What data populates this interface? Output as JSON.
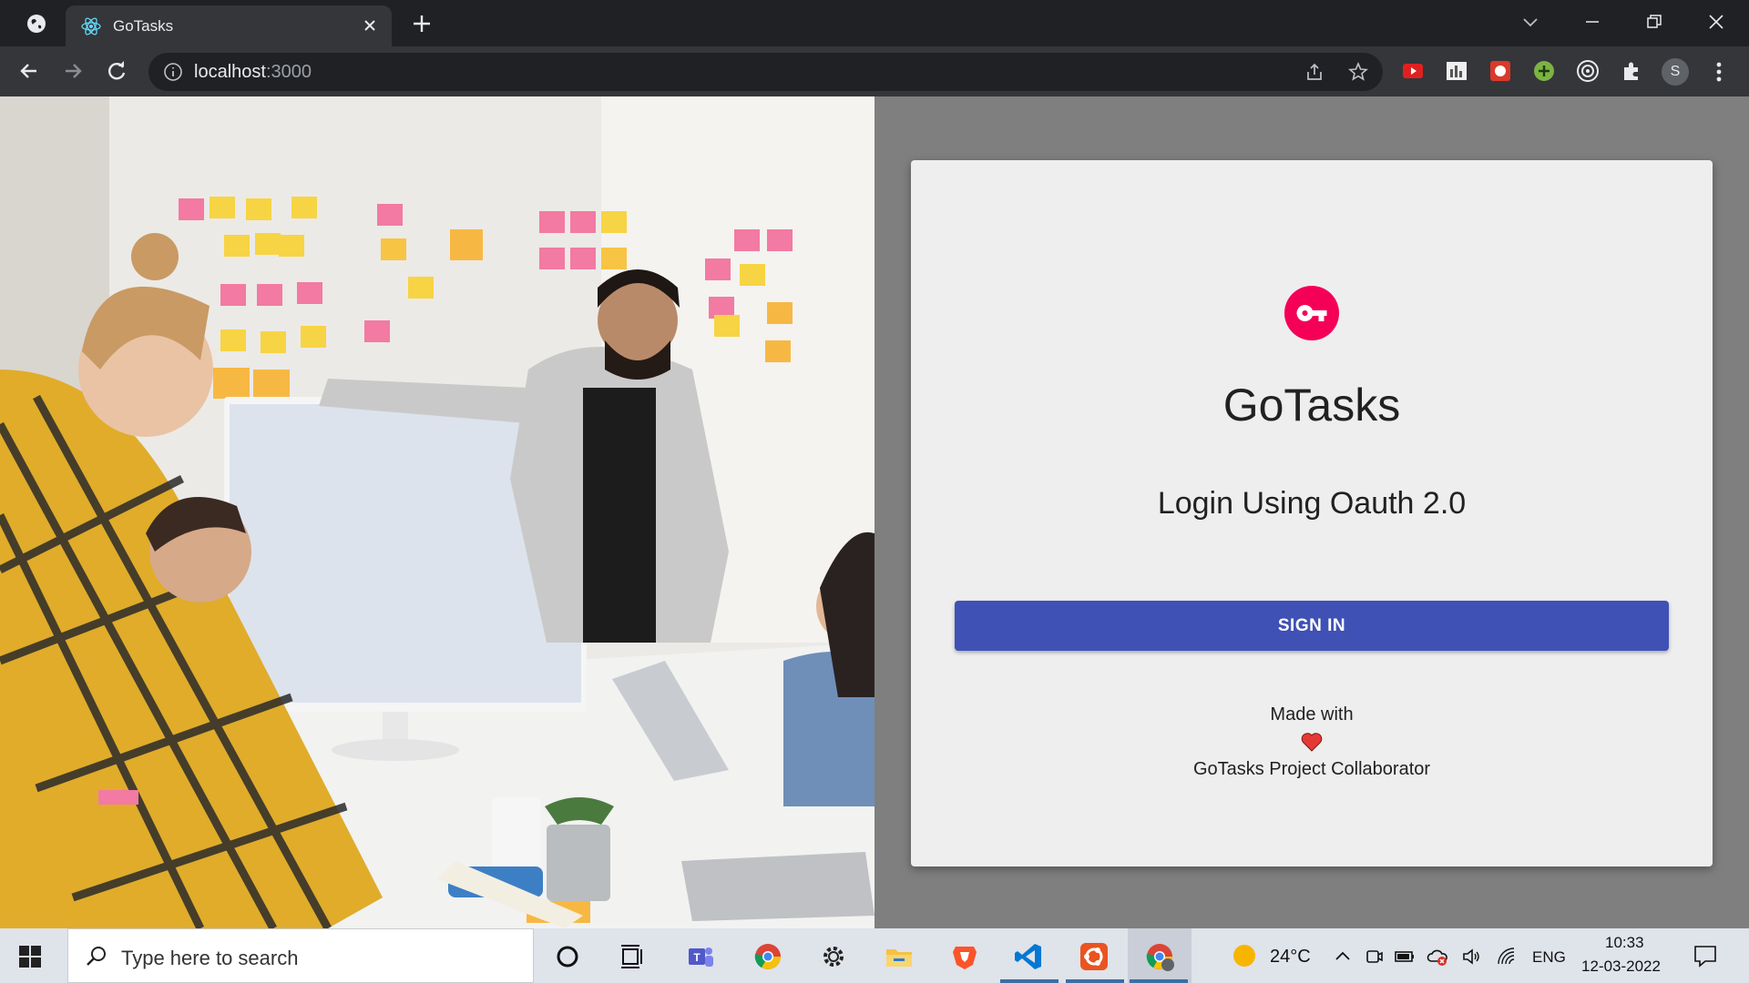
{
  "browser": {
    "tab_title": "GoTasks",
    "url_host": "localhost",
    "url_port": ":3000",
    "profile_initial": "S"
  },
  "card": {
    "app_name": "GoTasks",
    "subtitle": "Login Using Oauth 2.0",
    "signin_label": "SIGN IN",
    "made_with": "Made with",
    "footer_name": "GoTasks Project Collaborator",
    "accent_color": "#f50057",
    "button_color": "#3f51b5"
  },
  "taskbar": {
    "search_placeholder": "Type here to search",
    "temperature": "24°C",
    "language": "ENG",
    "time": "10:33",
    "date": "12-03-2022"
  }
}
